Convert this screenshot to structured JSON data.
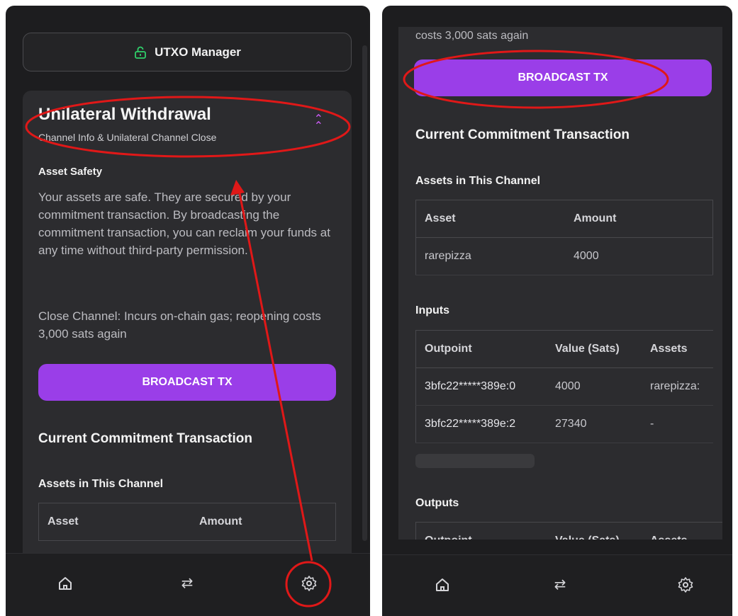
{
  "left": {
    "utxo_button_label": "UTXO Manager",
    "card": {
      "title": "Unilateral Withdrawal",
      "subtitle": "Channel Info & Unilateral Channel Close",
      "asset_safety_heading": "Asset Safety",
      "asset_safety_text": "Your assets are safe. They are secured by your commitment transaction. By broadcasting the commitment transaction, you can reclaim your funds at any time without third-party permission.",
      "close_channel_text": "Close Channel: Incurs on-chain gas; reopening costs 3,000 sats again",
      "broadcast_label": "BROADCAST TX",
      "commitment_heading": "Current Commitment Transaction",
      "assets_heading": "Assets in This Channel",
      "assets_table_headers": [
        "Asset",
        "Amount"
      ]
    }
  },
  "right": {
    "top_text": "costs 3,000 sats again",
    "broadcast_label": "BROADCAST TX",
    "commitment_heading": "Current Commitment Transaction",
    "assets_heading": "Assets in This Channel",
    "assets_table": {
      "headers": [
        "Asset",
        "Amount"
      ],
      "rows": [
        [
          "rarepizza",
          "4000"
        ]
      ]
    },
    "inputs_heading": "Inputs",
    "inputs_table": {
      "headers": [
        "Outpoint",
        "Value (Sats)",
        "Assets"
      ],
      "rows": [
        [
          "3bfc22*****389e:0",
          "4000",
          "rarepizza:"
        ],
        [
          "3bfc22*****389e:2",
          "27340",
          "-"
        ]
      ]
    },
    "outputs_heading": "Outputs",
    "outputs_table_headers": [
      "Outpoint",
      "Value (Sats)",
      "Assets"
    ]
  },
  "nav": {
    "icons": [
      "home-icon",
      "swap-icon",
      "settings-icon"
    ]
  },
  "colors": {
    "accent": "#9a3ee8",
    "annotation": "#e01818",
    "chevron": "#c85bf0",
    "lock": "#2fcf6a"
  }
}
